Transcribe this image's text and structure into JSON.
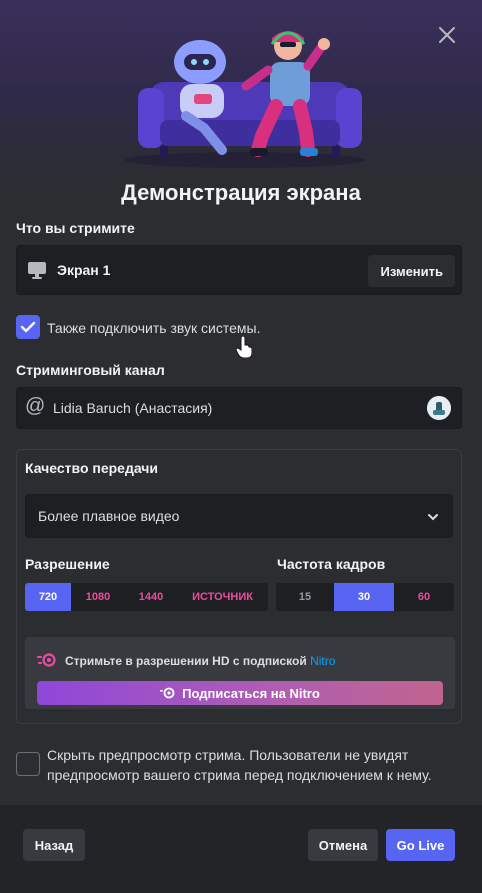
{
  "dialog": {
    "title": "Демонстрация экрана"
  },
  "source": {
    "section_label": "Что вы стримите",
    "name": "Экран 1",
    "change_label": "Изменить",
    "icon": "monitor-icon"
  },
  "audio": {
    "label": "Также подключить звук системы.",
    "checked": true
  },
  "channel": {
    "section_label": "Стриминговый канал",
    "name": "Lidia Baruch (Анастасия)",
    "icon": "at-icon"
  },
  "quality": {
    "section_label": "Качество передачи",
    "preset": "Более плавное видео",
    "resolution_label": "Разрешение",
    "resolutions": [
      "720",
      "1080",
      "1440",
      "ИСТОЧНИК"
    ],
    "selected_resolution": "720",
    "framerate_label": "Частота кадров",
    "framerates": [
      "15",
      "30",
      "60"
    ],
    "selected_framerate": "30",
    "nitro_text": "Стримьте в разрешении HD с подпиской",
    "nitro_link": "Nitro",
    "nitro_button": "Подписаться на Nitro"
  },
  "preview": {
    "label": "Скрыть предпросмотр стрима. Пользователи не увидят предпросмотр вашего стрима перед подключением к нему.",
    "checked": false
  },
  "footer": {
    "back_label": "Назад",
    "cancel_label": "Отмена",
    "golive_label": "Go Live"
  },
  "colors": {
    "accent": "#5865f2",
    "nitro_pink": "#ec4ba3",
    "link": "#00a8fc",
    "background": "#2b2d31",
    "input": "#1e1f22"
  }
}
